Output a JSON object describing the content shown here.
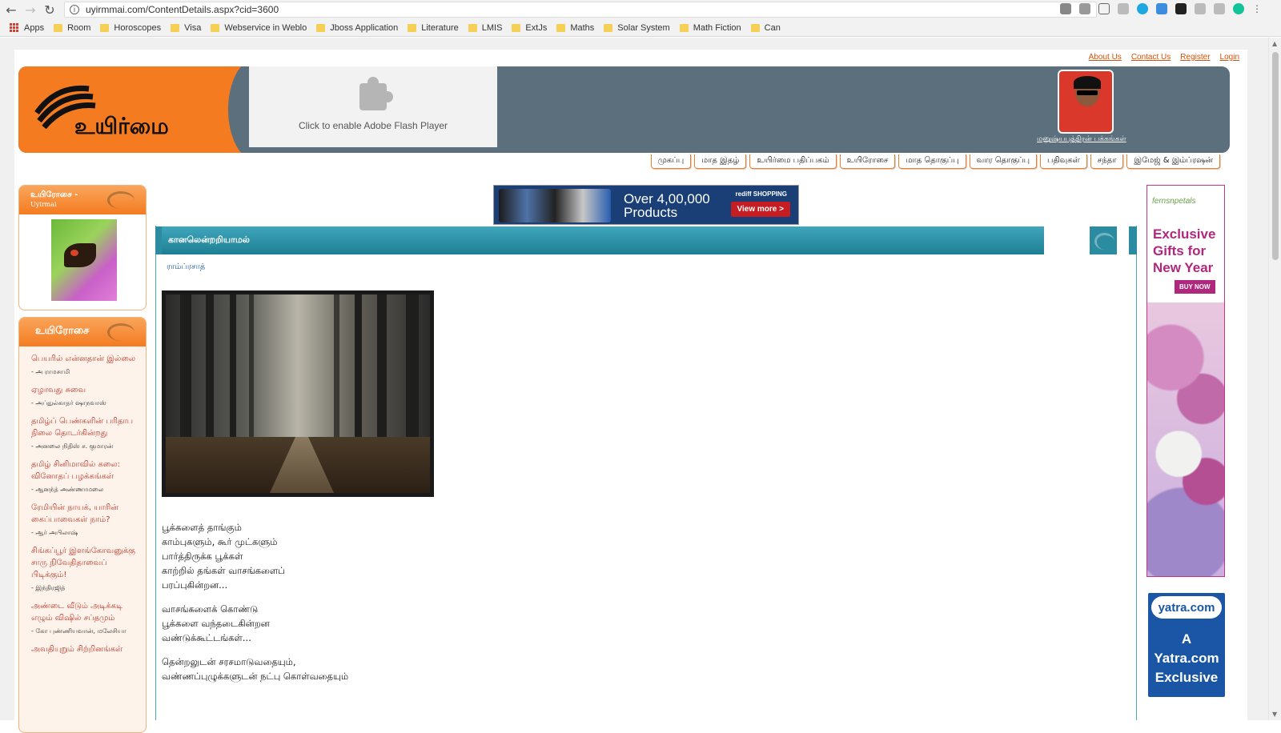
{
  "browser": {
    "url": "uyirmmai.com/ContentDetails.aspx?cid=3600",
    "bookmarks": [
      "Apps",
      "Room",
      "Horoscopes",
      "Visa",
      "Webservice in Weblo",
      "Jboss Application",
      "Literature",
      "LMIS",
      "ExtJs",
      "Maths",
      "Solar System",
      "Math Fiction",
      "Can"
    ]
  },
  "top_links": [
    "About Us",
    "Contact Us",
    "Register",
    "Login"
  ],
  "header": {
    "logo_text": "உயிர்மை",
    "flash_text": "Click to enable Adobe Flash Player",
    "profile_caption": "மனுஷ்யபுத்திரன் பக்கங்கள்"
  },
  "menu": [
    "முகப்பு",
    "மாத இதழ்",
    "உயிர்மை பதிப்பகம்",
    "உயிரோசை",
    "மாத தொகுப்பு",
    "வார தொகுப்பு",
    "பதிவுகள்",
    "சந்தா",
    "இமேஜ் & இம்ப்ரஷன்"
  ],
  "sidebar": {
    "panel1_title": "உயிரோசை -",
    "panel1_subtitle": "Uyirmai",
    "panel2_title": "உயிரோசை",
    "stories": [
      {
        "title": "பெயரில் என்னதான் இல்லை",
        "author": "- அ ராமசாமி"
      },
      {
        "title": "ஏழாவது சுவை",
        "author": "- அப்துல்காதர் ஷாநவாஸ்"
      },
      {
        "title": "தமிழ்ப் பெண்களின் பரிதாப நிலை தொடர்கின்றது",
        "author": "- அனலை நிதிஸ் ச. குமாரன்"
      },
      {
        "title": "தமிழ் சினிமாவில் கலை: வினோதப் பழக்கங்கள்",
        "author": "- ஆனந்த் அண்ணாமலை"
      },
      {
        "title": "ரேமியின் நாயக், யாரின் கைப்பாவைகள் நாம்?",
        "author": "- ஆர் அபிலாஷ்"
      },
      {
        "title": "சிங்கப்பூர் இளங்கோவனுக்கு சாரு நிவேதிதாவைப் பிடிக்கும்!",
        "author": "- இந்திரஜித்"
      },
      {
        "title": "அண்டை வீடும் அடிக்கடி எழும் விஷில் சப்தமும்",
        "author": "- கோ புண்ணியவான், மலேசியா"
      },
      {
        "title": "அவதியுறும் சிற்றினங்கள்",
        "author": ""
      }
    ]
  },
  "ad_banner": {
    "brand": "rediff SHOPPING",
    "headline_line1": "Over 4,00,000",
    "headline_line2": "Products",
    "cta": "View more >"
  },
  "article": {
    "title": "கானலென்றறியாமல்",
    "author": "ராம்ப்ரசாத்",
    "stanzas": [
      [
        "பூக்களைத் தாங்கும்",
        "காம்புகளும், கூர் முட்களும்",
        "பார்த்திருக்க பூக்கள்",
        "காற்றில் தங்கள் வாசங்களைப்",
        "பரப்புகின்றன..."
      ],
      [
        "வாசங்களைக் கொண்டு",
        "பூக்களை வந்தடைகின்றன",
        "வண்டுக்கூட்டங்கள்..."
      ],
      [
        "தென்றலுடன் சரசமாடுவதையும்,",
        "வண்ணப்புழுக்களுடன் நட்பு கொள்வதையும்"
      ]
    ]
  },
  "ad_right": {
    "brand": "fernsnpetals",
    "headline": [
      "Exclusive",
      "Gifts for",
      "New Year"
    ],
    "cta": "BUY NOW"
  },
  "ad_yatra": {
    "brand": "yatra.com",
    "text": [
      "A",
      "Yatra.com",
      "Exclusive"
    ]
  }
}
